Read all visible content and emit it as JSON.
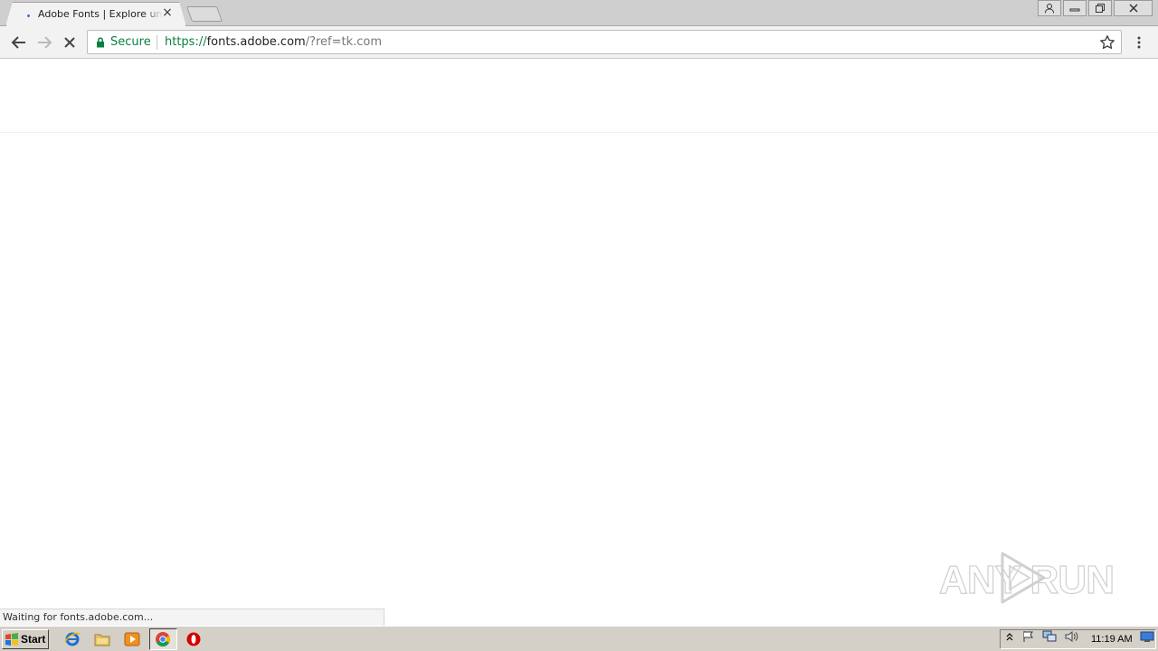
{
  "browser": {
    "tab": {
      "title": "Adobe Fonts | Explore unlimited fonts"
    },
    "omnibox": {
      "security_label": "Secure",
      "url_scheme": "https://",
      "url_host": "fonts.adobe.com",
      "url_rest": "/?ref=tk.com"
    },
    "status_text": "Waiting for fonts.adobe.com..."
  },
  "watermark": {
    "text": "ANY RUN"
  },
  "taskbar": {
    "start_label": "Start",
    "clock": "11:19 AM",
    "pinned_icons": [
      "internet-explorer-icon",
      "file-explorer-icon",
      "media-player-icon",
      "chrome-icon",
      "opera-icon"
    ]
  },
  "colors": {
    "secure_green": "#0b8043",
    "tab_bar": "#cfcfcf",
    "taskbar": "#d4d0c8"
  }
}
